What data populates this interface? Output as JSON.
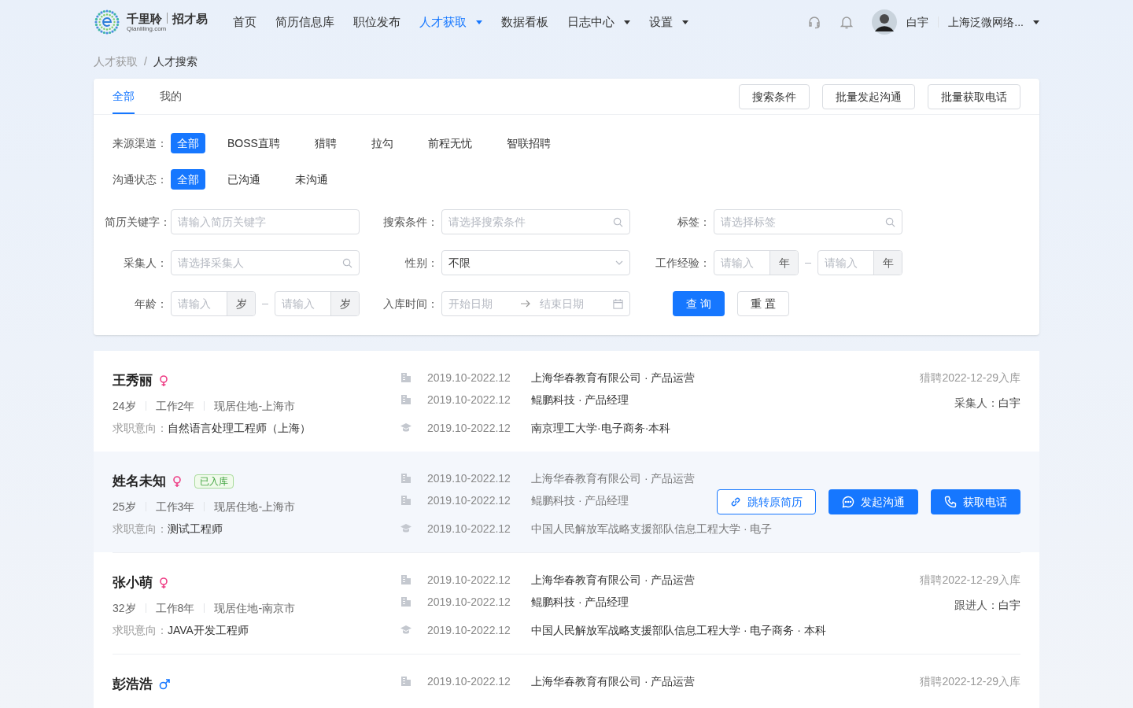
{
  "header": {
    "logo": {
      "name": "千里聆",
      "product": "招才易",
      "domain": "Qianliling.com"
    },
    "nav": [
      {
        "label": "首页",
        "selected": false,
        "has_menu": false
      },
      {
        "label": "简历信息库",
        "selected": false,
        "has_menu": false
      },
      {
        "label": "职位发布",
        "selected": false,
        "has_menu": false
      },
      {
        "label": "人才获取",
        "selected": true,
        "has_menu": true
      },
      {
        "label": "数据看板",
        "selected": false,
        "has_menu": false
      },
      {
        "label": "日志中心",
        "selected": false,
        "has_menu": true
      },
      {
        "label": "设置",
        "selected": false,
        "has_menu": true
      }
    ],
    "user": "白宇",
    "company": "上海泛微网络..."
  },
  "breadcrumb": {
    "items": [
      "人才获取",
      "人才搜索"
    ],
    "separator": "/"
  },
  "filter": {
    "tabs": [
      {
        "label": "全部",
        "selected": true
      },
      {
        "label": "我的",
        "selected": false
      }
    ],
    "actions": [
      "搜索条件",
      "批量发起沟通",
      "批量获取电话"
    ],
    "option_groups": [
      {
        "label": "来源渠道：",
        "options": [
          {
            "label": "全部",
            "selected": true
          },
          {
            "label": "BOSS直聘",
            "selected": false
          },
          {
            "label": "猎聘",
            "selected": false
          },
          {
            "label": "拉勾",
            "selected": false
          },
          {
            "label": "前程无忧",
            "selected": false
          },
          {
            "label": "智联招聘",
            "selected": false
          }
        ]
      },
      {
        "label": "沟通状态：",
        "options": [
          {
            "label": "全部",
            "selected": true
          },
          {
            "label": "已沟通",
            "selected": false
          },
          {
            "label": "未沟通",
            "selected": false
          }
        ]
      }
    ],
    "fields": [
      {
        "kind": "text",
        "label": "简历关键字：",
        "placeholder": "请输入简历关键字"
      },
      {
        "kind": "search",
        "label": "搜索条件：",
        "placeholder": "请选择搜索条件"
      },
      {
        "kind": "search",
        "label": "标签：",
        "placeholder": "请选择标签"
      },
      {
        "kind": "search",
        "label": "采集人：",
        "placeholder": "请选择采集人"
      },
      {
        "kind": "select",
        "label": "性别：",
        "value": "不限"
      },
      {
        "kind": "range",
        "label": "工作经验：",
        "from": {
          "placeholder": "请输入",
          "unit": "年"
        },
        "to": {
          "placeholder": "请输入",
          "unit": "年"
        }
      },
      {
        "kind": "range",
        "label": "年龄：",
        "from": {
          "placeholder": "请输入",
          "unit": "岁"
        },
        "to": {
          "placeholder": "请输入",
          "unit": "岁"
        }
      },
      {
        "kind": "daterange",
        "label": "入库时间：",
        "start": "开始日期",
        "end": "结束日期"
      }
    ],
    "query": "查 询",
    "reset": "重 置"
  },
  "candidates": [
    {
      "name": "王秀丽",
      "kind": "female",
      "selected": false,
      "age": "24岁",
      "experience": "工作2年",
      "location": "现居住地-上海市",
      "intention_label": "求职意向：",
      "intention": "自然语言处理工程师（上海）",
      "history": [
        {
          "kind": "work",
          "period": "2019.10-2022.12",
          "detail": "上海华春教育有限公司 · 产品运营"
        },
        {
          "kind": "work",
          "period": "2019.10-2022.12",
          "detail": "鲲鹏科技 · 产品经理"
        },
        {
          "kind": "edu",
          "period": "2019.10-2022.12",
          "detail": "南京理工大学·电子商务·本科"
        }
      ],
      "source": "猎聘2022-12-29入库",
      "owner_label": "采集人：",
      "owner": "白宇"
    },
    {
      "name": "姓名未知",
      "kind": "female",
      "tag": "已入库",
      "selected": true,
      "age": "25岁",
      "experience": "工作3年",
      "location": "现居住地-上海市",
      "intention_label": "求职意向：",
      "intention": "测试工程师",
      "history": [
        {
          "kind": "work",
          "period": "2019.10-2022.12",
          "detail": "上海华春教育有限公司 · 产品运营"
        },
        {
          "kind": "work",
          "period": "2019.10-2022.12",
          "detail": "鲲鹏科技 · 产品经理"
        },
        {
          "kind": "edu",
          "period": "2019.10-2022.12",
          "detail": "中国人民解放军战略支援部队信息工程大学 · 电子"
        }
      ],
      "actions": [
        {
          "kind": "link",
          "label": "跳转原简历"
        },
        {
          "kind": "chat",
          "label": "发起沟通"
        },
        {
          "kind": "phone",
          "label": "获取电话"
        }
      ]
    },
    {
      "name": "张小萌",
      "kind": "female",
      "selected": false,
      "age": "32岁",
      "experience": "工作8年",
      "location": "现居住地-南京市",
      "intention_label": "求职意向：",
      "intention": "JAVA开发工程师",
      "history": [
        {
          "kind": "work",
          "period": "2019.10-2022.12",
          "detail": "上海华春教育有限公司 · 产品运营"
        },
        {
          "kind": "work",
          "period": "2019.10-2022.12",
          "detail": "鲲鹏科技 · 产品经理"
        },
        {
          "kind": "edu",
          "period": "2019.10-2022.12",
          "detail": "中国人民解放军战略支援部队信息工程大学 · 电子商务 · 本科"
        }
      ],
      "source": "猎聘2022-12-29入库",
      "owner_label": "跟进人：",
      "owner": "白宇"
    },
    {
      "name": "彭浩浩",
      "kind": "male",
      "selected": false,
      "history": [
        {
          "kind": "work",
          "period": "2019.10-2022.12",
          "detail": "上海华春教育有限公司 · 产品运营"
        }
      ],
      "source": "猎聘2022-12-29入库"
    }
  ]
}
